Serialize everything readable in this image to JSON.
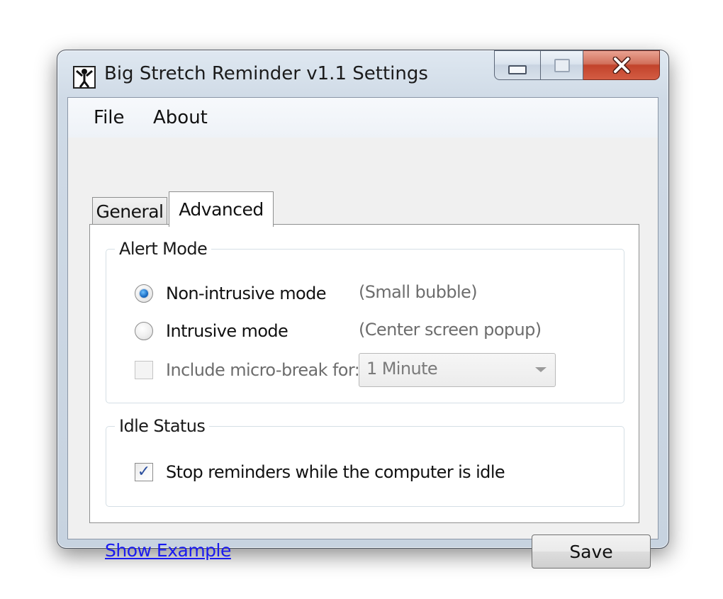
{
  "window": {
    "title": "Big Stretch Reminder v1.1 Settings",
    "close_glyph": "X",
    "icon": "stretch-figure-icon"
  },
  "menu": {
    "file": "File",
    "about": "About"
  },
  "tabs": [
    {
      "label": "General",
      "active": false
    },
    {
      "label": "Advanced",
      "active": true
    }
  ],
  "alert_mode": {
    "legend": "Alert Mode",
    "options": [
      {
        "label": "Non-intrusive mode",
        "hint": "(Small bubble)",
        "selected": true
      },
      {
        "label": "Intrusive mode",
        "hint": "(Center screen popup)",
        "selected": false
      }
    ],
    "micro_break": {
      "label": "Include micro-break for:",
      "checked": false,
      "enabled": false,
      "selected_value": "1 Minute"
    }
  },
  "idle_status": {
    "legend": "Idle Status",
    "stop_when_idle": {
      "label": "Stop reminders while the computer is idle",
      "checked": true
    }
  },
  "footer": {
    "show_example": "Show Example",
    "save": "Save"
  },
  "colors": {
    "link": "#1a1af0",
    "close_button": "#c2432b",
    "radio_selected": "#1a6cc4"
  }
}
